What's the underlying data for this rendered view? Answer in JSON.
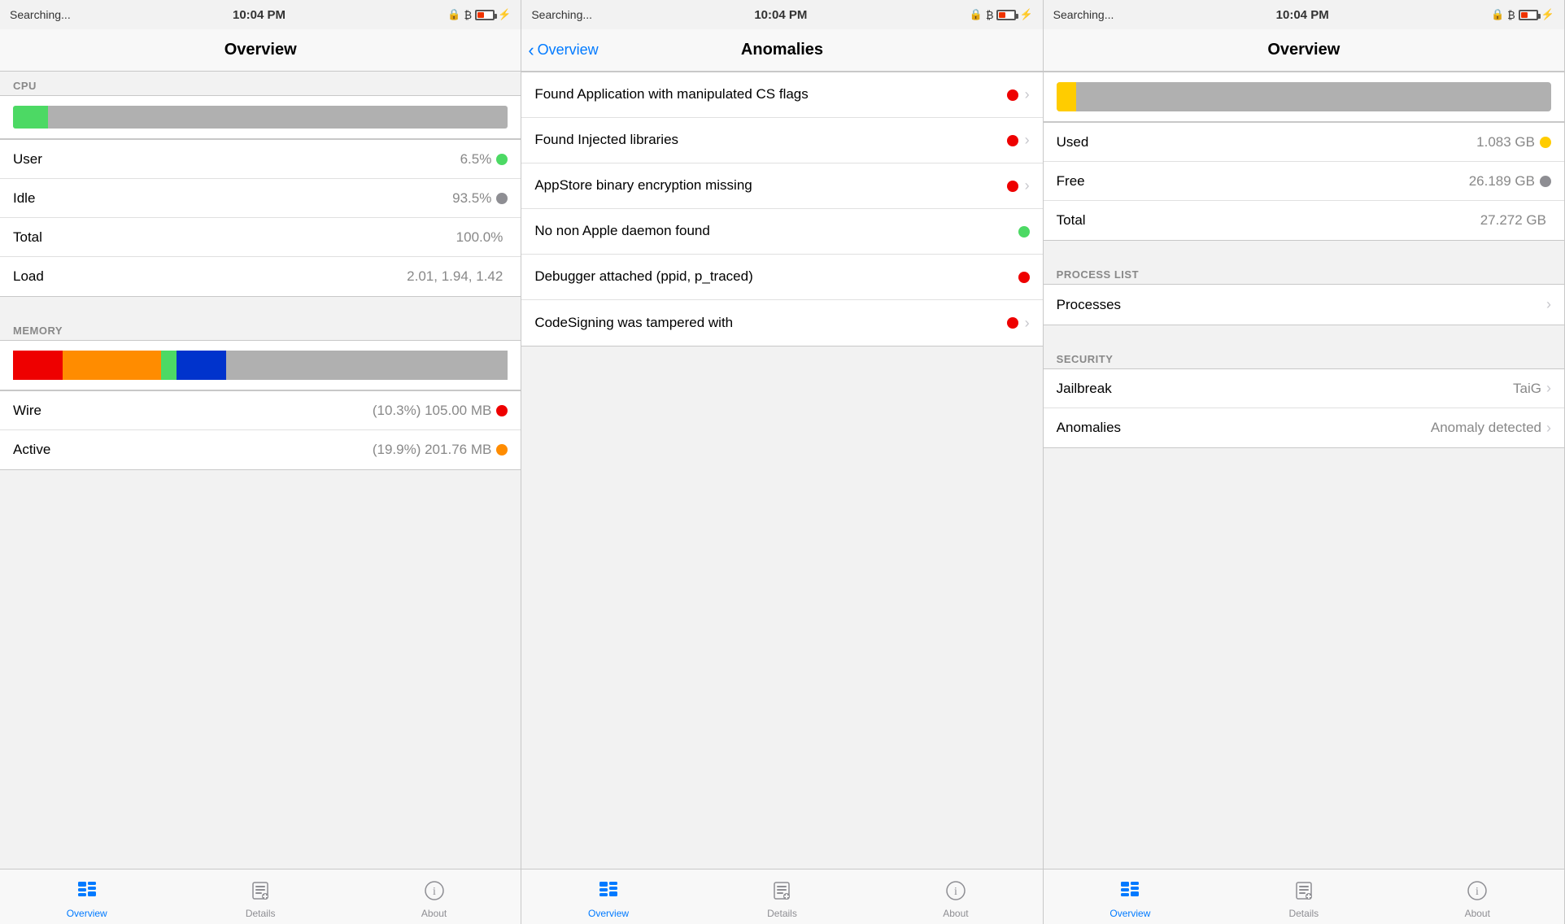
{
  "panels": [
    {
      "id": "panel1",
      "statusBar": {
        "left": "Searching...",
        "center": "10:04 PM",
        "right": "🔒 ₿ 🔋 ⚡"
      },
      "navTitle": "Overview",
      "hasBack": false,
      "sections": [
        {
          "type": "section-header",
          "label": "CPU"
        },
        {
          "type": "cpu-bar"
        },
        {
          "type": "list",
          "items": [
            {
              "label": "User",
              "value": "6.5%",
              "dot": "green"
            },
            {
              "label": "Idle",
              "value": "93.5%",
              "dot": "gray"
            },
            {
              "label": "Total",
              "value": "100.0%",
              "dot": null
            },
            {
              "label": "Load",
              "value": "2.01, 1.94, 1.42",
              "dot": null
            }
          ]
        },
        {
          "type": "section-header",
          "label": "MEMORY"
        },
        {
          "type": "memory-bar"
        },
        {
          "type": "list",
          "items": [
            {
              "label": "Wire",
              "value": "(10.3%) 105.00 MB",
              "dot": "red"
            },
            {
              "label": "Active",
              "value": "(19.9%) 201.76 MB",
              "dot": "orange"
            }
          ]
        }
      ],
      "tabBar": {
        "items": [
          {
            "label": "Overview",
            "active": true,
            "icon": "overview"
          },
          {
            "label": "Details",
            "active": false,
            "icon": "details"
          },
          {
            "label": "About",
            "active": false,
            "icon": "about"
          }
        ]
      }
    },
    {
      "id": "panel2",
      "statusBar": {
        "left": "Searching...",
        "center": "10:04 PM"
      },
      "navTitle": "Anomalies",
      "hasBack": true,
      "backLabel": "Overview",
      "anomalies": [
        {
          "text": "Found Application with manipulated CS flags",
          "dot": "red",
          "hasChevron": true
        },
        {
          "text": "Found Injected libraries",
          "dot": "red",
          "hasChevron": true
        },
        {
          "text": "AppStore binary encryption missing",
          "dot": "red",
          "hasChevron": true
        },
        {
          "text": "No non Apple daemon found",
          "dot": "green",
          "hasChevron": false
        },
        {
          "text": "Debugger attached (ppid, p_traced)",
          "dot": "red",
          "hasChevron": false
        },
        {
          "text": "CodeSigning was tampered with",
          "dot": "red",
          "hasChevron": true
        }
      ],
      "tabBar": {
        "items": [
          {
            "label": "Overview",
            "active": true,
            "icon": "overview"
          },
          {
            "label": "Details",
            "active": false,
            "icon": "details"
          },
          {
            "label": "About",
            "active": false,
            "icon": "about"
          }
        ]
      }
    },
    {
      "id": "panel3",
      "statusBar": {
        "left": "Searching...",
        "center": "10:04 PM"
      },
      "navTitle": "Overview",
      "hasBack": false,
      "diskBar": true,
      "diskItems": [
        {
          "label": "Used",
          "value": "1.083 GB",
          "dot": "yellow"
        },
        {
          "label": "Free",
          "value": "26.189 GB",
          "dot": "gray"
        },
        {
          "label": "Total",
          "value": "27.272 GB",
          "dot": null
        }
      ],
      "processList": {
        "header": "PROCESS LIST",
        "label": "Processes"
      },
      "security": {
        "header": "SECURITY",
        "items": [
          {
            "label": "Jailbreak",
            "value": "TaiG",
            "hasChevron": true
          },
          {
            "label": "Anomalies",
            "value": "Anomaly detected",
            "hasChevron": true
          }
        ]
      },
      "tabBar": {
        "items": [
          {
            "label": "Overview",
            "active": true,
            "icon": "overview"
          },
          {
            "label": "Details",
            "active": false,
            "icon": "details"
          },
          {
            "label": "About",
            "active": false,
            "icon": "about"
          }
        ]
      }
    }
  ]
}
